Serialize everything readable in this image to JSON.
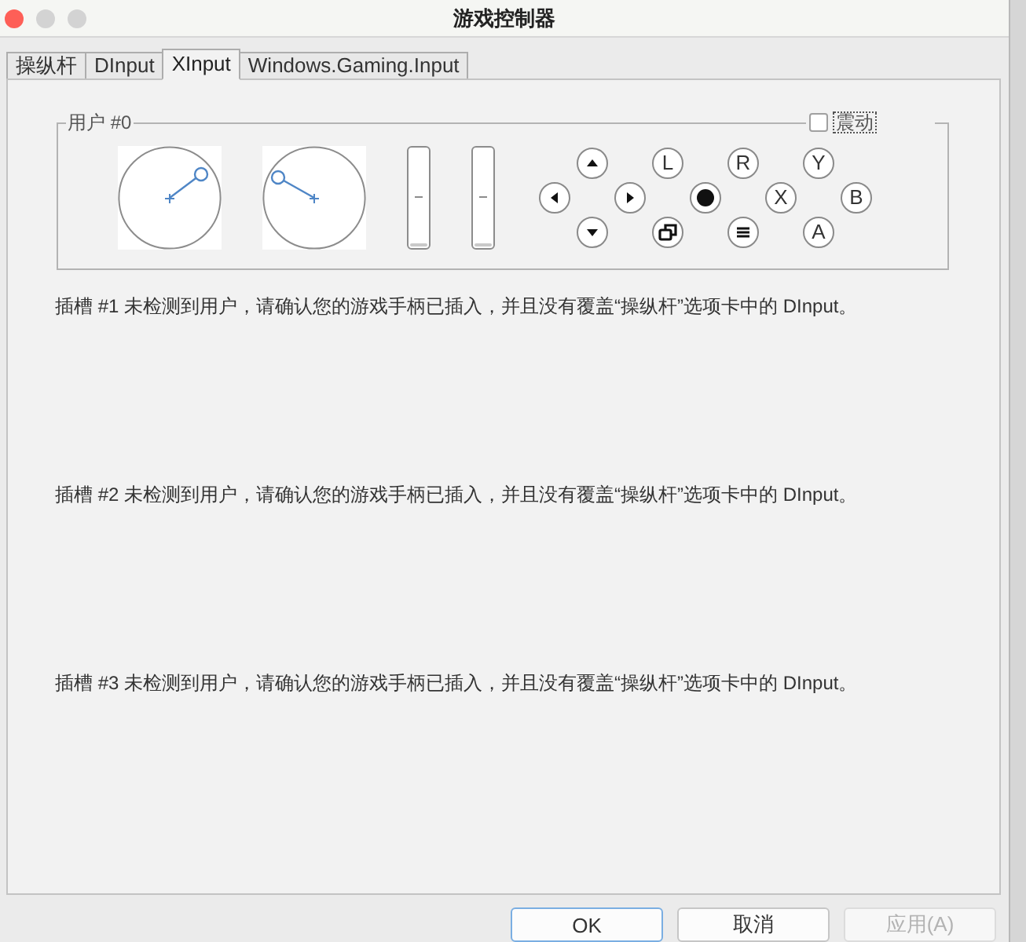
{
  "window": {
    "title": "游戏控制器"
  },
  "tabs": [
    {
      "label": "操纵杆",
      "selected": false
    },
    {
      "label": "DInput",
      "selected": false
    },
    {
      "label": "XInput",
      "selected": true
    },
    {
      "label": "Windows.Gaming.Input",
      "selected": false
    }
  ],
  "user_group": {
    "legend": "用户 #0",
    "vibration": {
      "label": "震动",
      "checked": false,
      "focused": true
    },
    "triggers": [
      {
        "level": 0
      },
      {
        "level": 0
      }
    ],
    "buttons": [
      {
        "kind": "up"
      },
      {
        "kind": "letter",
        "label": "L"
      },
      {
        "kind": "letter",
        "label": "R"
      },
      {
        "kind": "letter",
        "label": "Y"
      },
      {
        "kind": "left"
      },
      {
        "kind": "right"
      },
      {
        "kind": "guide"
      },
      {
        "kind": "letter",
        "label": "X"
      },
      {
        "kind": "letter",
        "label": "B"
      },
      {
        "kind": "down"
      },
      {
        "kind": "back"
      },
      {
        "kind": "start"
      },
      {
        "kind": "letter",
        "label": "A"
      }
    ]
  },
  "slot_messages": [
    "插槽 #1 未检测到用户，请确认您的游戏手柄已插入，并且没有覆盖“操纵杆”选项卡中的 DInput。",
    "插槽 #2 未检测到用户，请确认您的游戏手柄已插入，并且没有覆盖“操纵杆”选项卡中的 DInput。",
    "插槽 #3 未检测到用户，请确认您的游戏手柄已插入，并且没有覆盖“操纵杆”选项卡中的 DInput。"
  ],
  "dialog_buttons": [
    {
      "label": "OK",
      "default": true,
      "disabled": false
    },
    {
      "label": "取消",
      "default": false,
      "disabled": false
    },
    {
      "label": "应用(A)",
      "default": false,
      "disabled": true
    }
  ]
}
